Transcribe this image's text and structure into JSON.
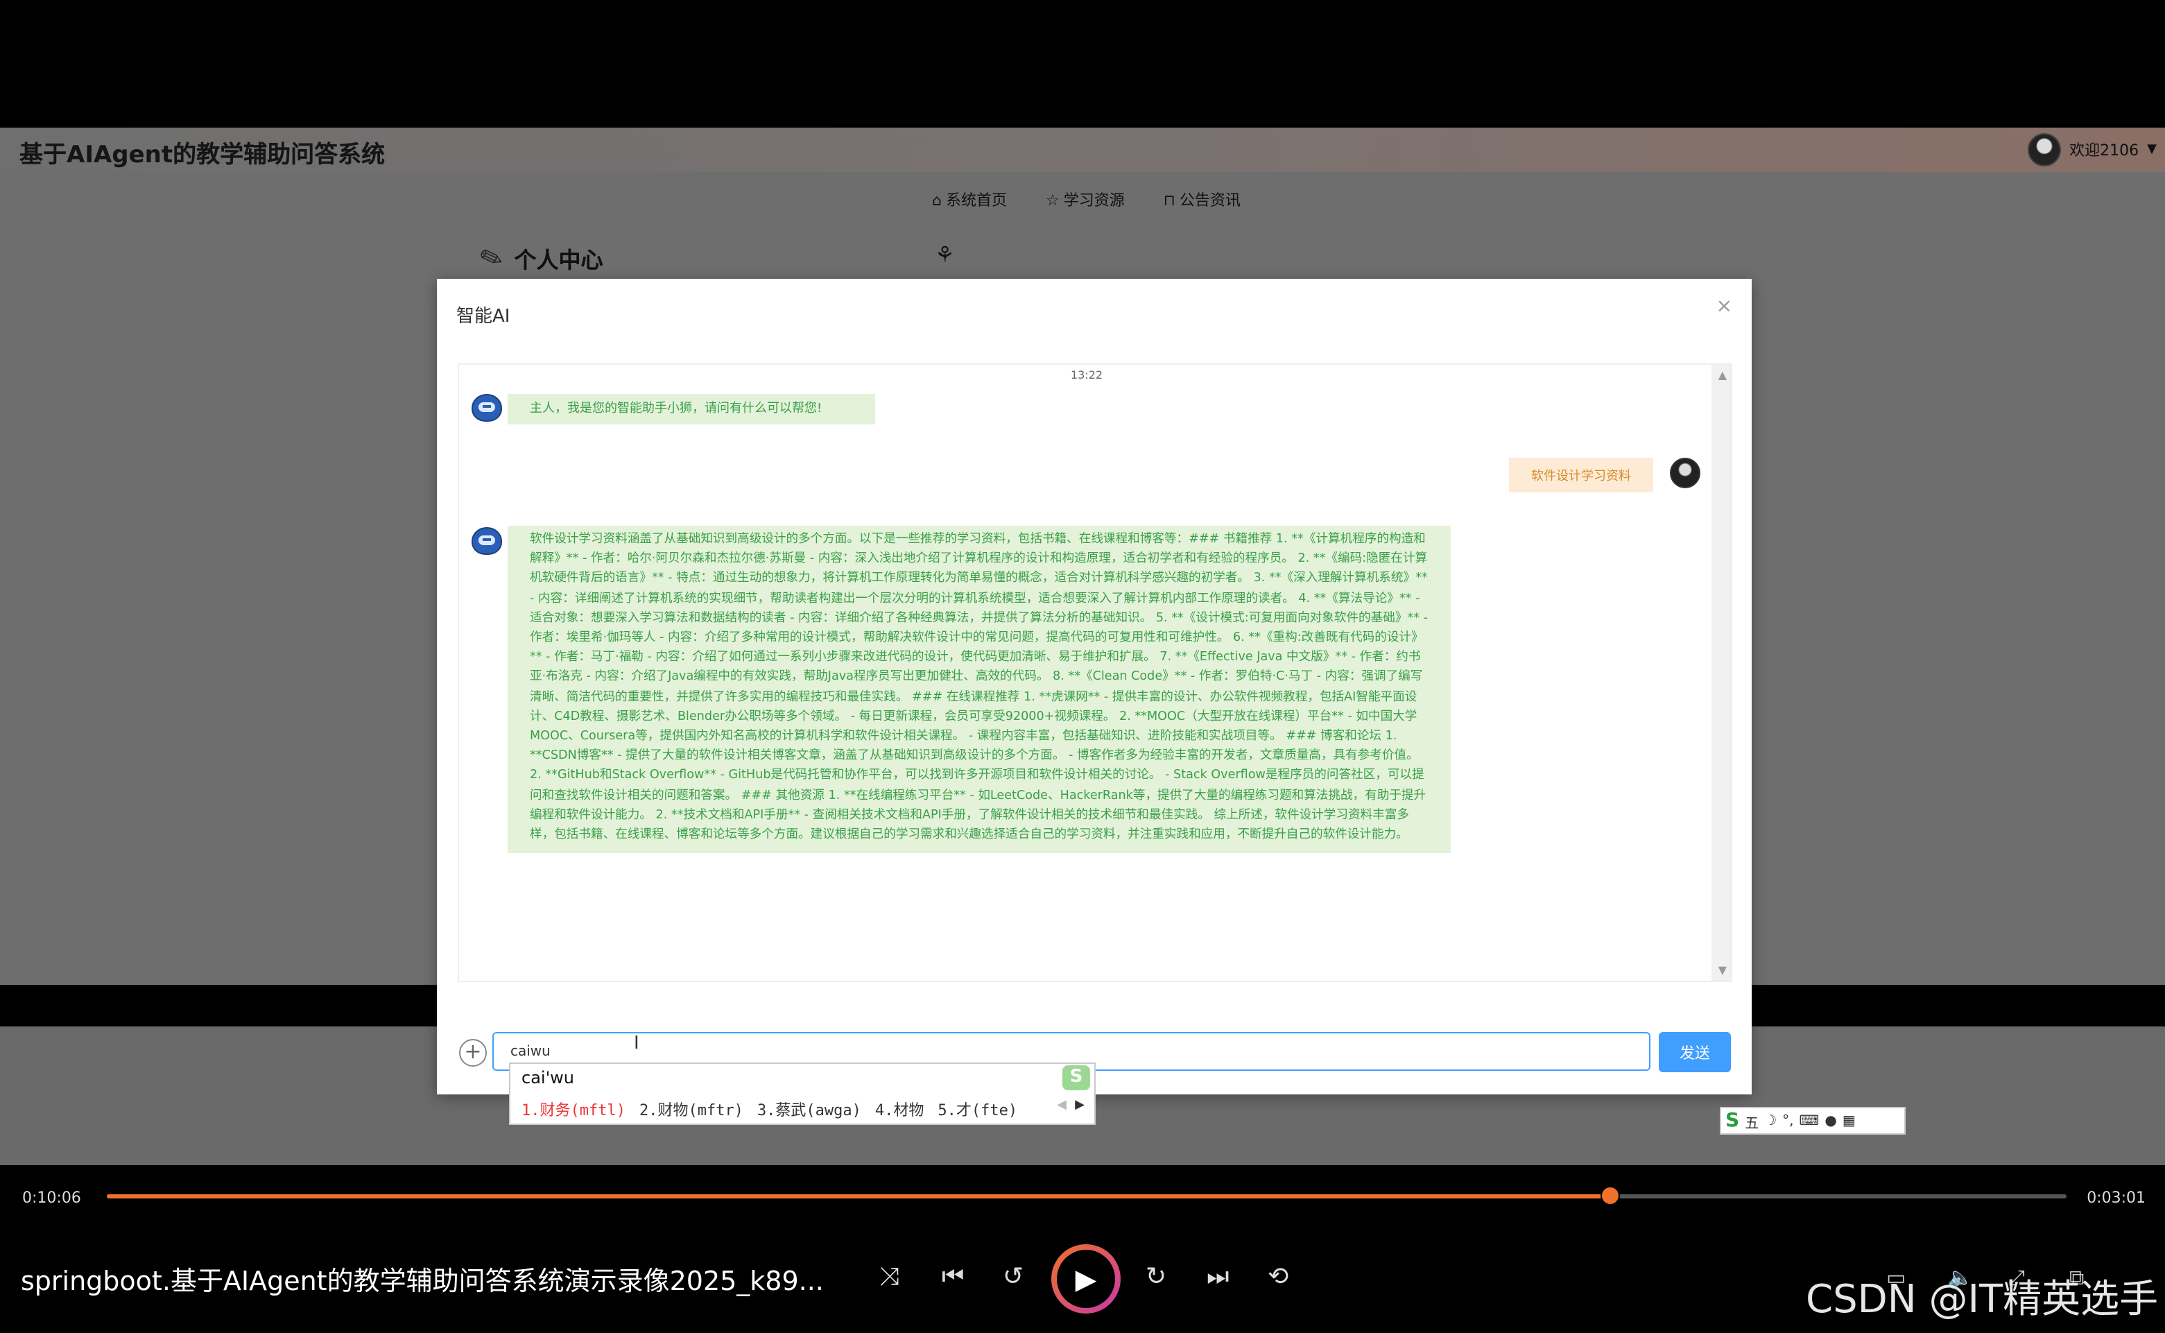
{
  "app": {
    "title": "基于AIAgent的教学辅助问答系统",
    "welcome": "欢迎2106",
    "nav": [
      {
        "label": "系统首页",
        "icon": "home-icon"
      },
      {
        "label": "学习资源",
        "icon": "star-icon"
      },
      {
        "label": "公告资讯",
        "icon": "lock-icon"
      }
    ],
    "page_heading": "个人中心"
  },
  "modal": {
    "title": "智能AI",
    "close": "×",
    "time": "13:22",
    "messages": [
      {
        "role": "bot",
        "text": "主人，我是您的智能助手小狮，请问有什么可以帮您!"
      },
      {
        "role": "user",
        "text": "软件设计学习资料"
      },
      {
        "role": "bot",
        "text": "软件设计学习资料涵盖了从基础知识到高级设计的多个方面。以下是一些推荐的学习资料，包括书籍、在线课程和博客等：### 书籍推荐 1. **《计算机程序的构造和解释》** - 作者：哈尔·阿贝尔森和杰拉尔德·苏斯曼 - 内容：深入浅出地介绍了计算机程序的设计和构造原理，适合初学者和有经验的程序员。 2. **《编码:隐匿在计算机软硬件背后的语言》** - 特点：通过生动的想象力，将计算机工作原理转化为简单易懂的概念，适合对计算机科学感兴趣的初学者。 3. **《深入理解计算机系统》** - 内容：详细阐述了计算机系统的实现细节，帮助读者构建出一个层次分明的计算机系统模型，适合想要深入了解计算机内部工作原理的读者。 4. **《算法导论》** - 适合对象：想要深入学习算法和数据结构的读者 - 内容：详细介绍了各种经典算法，并提供了算法分析的基础知识。 5. **《设计模式:可复用面向对象软件的基础》** - 作者：埃里希·伽玛等人 - 内容：介绍了多种常用的设计模式，帮助解决软件设计中的常见问题，提高代码的可复用性和可维护性。 6. **《重构:改善既有代码的设计》** - 作者：马丁·福勒 - 内容：介绍了如何通过一系列小步骤来改进代码的设计，使代码更加清晰、易于维护和扩展。 7. **《Effective Java 中文版》** - 作者：约书亚·布洛克 - 内容：介绍了Java编程中的有效实践，帮助Java程序员写出更加健壮、高效的代码。 8. **《Clean Code》** - 作者：罗伯特·C·马丁 - 内容：强调了编写清晰、简洁代码的重要性，并提供了许多实用的编程技巧和最佳实践。 ### 在线课程推荐 1. **虎课网** - 提供丰富的设计、办公软件视频教程，包括AI智能平面设计、C4D教程、摄影艺术、Blender办公职场等多个领域。 - 每日更新课程，会员可享受92000+视频课程。 2. **MOOC（大型开放在线课程）平台** - 如中国大学MOOC、Coursera等，提供国内外知名高校的计算机科学和软件设计相关课程。 - 课程内容丰富，包括基础知识、进阶技能和实战项目等。 ### 博客和论坛 1. **CSDN博客** - 提供了大量的软件设计相关博客文章，涵盖了从基础知识到高级设计的多个方面。 - 博客作者多为经验丰富的开发者，文章质量高，具有参考价值。 2. **GitHub和Stack Overflow** - GitHub是代码托管和协作平台，可以找到许多开源项目和软件设计相关的讨论。 - Stack Overflow是程序员的问答社区，可以提问和查找软件设计相关的问题和答案。 ### 其他资源 1. **在线编程练习平台** - 如LeetCode、HackerRank等，提供了大量的编程练习题和算法挑战，有助于提升编程和软件设计能力。 2. **技术文档和API手册** - 查阅相关技术文档和API手册，了解软件设计相关的技术细节和最佳实践。 综上所述，软件设计学习资料丰富多样，包括书籍、在线课程、博客和论坛等多个方面。建议根据自己的学习需求和兴趣选择适合自己的学习资料，并注重实践和应用，不断提升自己的软件设计能力。"
      }
    ],
    "input_value": "caiwu",
    "send_label": "发送"
  },
  "ime": {
    "pinyin": "cai'wu",
    "candidates": [
      "1.财务(mftl)",
      "2.财物(mftr)",
      "3.蔡武(awga)",
      "4.材物",
      "5.才(fte)"
    ],
    "toolbar_label": "五"
  },
  "player": {
    "elapsed": "0:10:06",
    "remaining": "0:03:01",
    "progress": 0.767,
    "title": "springboot.基于AIAgent的教学辅助问答系统演示录像2025_k89...",
    "watermark": "CSDN @IT精英选手"
  }
}
